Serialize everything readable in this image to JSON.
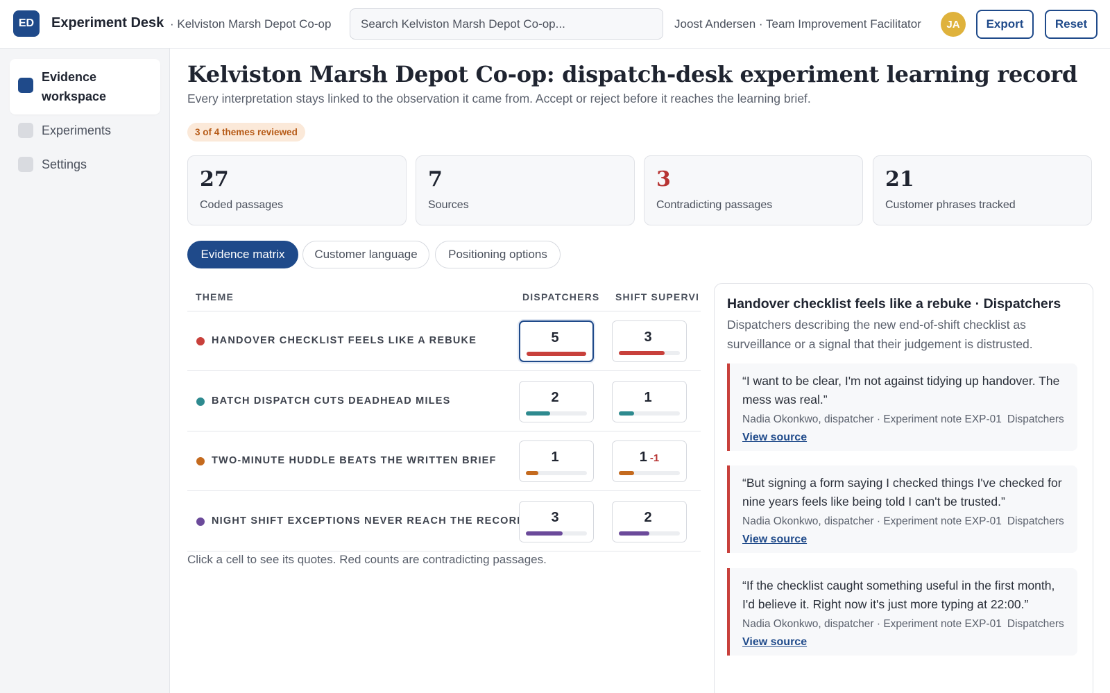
{
  "app": {
    "logo_initials": "ED",
    "title": "Experiment Desk",
    "breadcrumb": "· Kelviston Marsh Depot Co-op"
  },
  "search": {
    "placeholder": "Search Kelviston Marsh Depot Co-op..."
  },
  "user": {
    "name": "Joost Andersen · Team Improvement Facilitator",
    "initials": "JA"
  },
  "actions": {
    "export": "Export",
    "reset": "Reset"
  },
  "sidebar": {
    "items": [
      {
        "label": "Evidence workspace",
        "active": true
      },
      {
        "label": "Experiments",
        "active": false
      },
      {
        "label": "Settings",
        "active": false
      }
    ]
  },
  "page": {
    "title": "Kelviston Marsh Depot Co-op: dispatch-desk experiment learning record",
    "subtitle": "Every interpretation stays linked to the observation it came from. Accept or reject before it reaches the learning brief.",
    "review_badge": "3 of 4 themes reviewed"
  },
  "stats": [
    {
      "value": "27",
      "label": "Coded passages"
    },
    {
      "value": "7",
      "label": "Sources"
    },
    {
      "value": "3",
      "label": "Contradicting passages"
    },
    {
      "value": "21",
      "label": "Customer phrases tracked"
    }
  ],
  "tabs": [
    {
      "label": "Evidence matrix",
      "active": true
    },
    {
      "label": "Customer language",
      "active": false
    },
    {
      "label": "Positioning options",
      "active": false
    }
  ],
  "matrix": {
    "headers": [
      "THEME",
      "DISPATCHERS",
      "SHIFT SUPERVI"
    ],
    "rows": [
      {
        "theme": "HANDOVER CHECKLIST FEELS LIKE A REBUKE",
        "color": "#c8403b",
        "cells": [
          {
            "count": "5",
            "fill": 1.0,
            "contra": ""
          },
          {
            "count": "3",
            "fill": 0.75,
            "contra": ""
          }
        ]
      },
      {
        "theme": "BATCH DISPATCH CUTS DEADHEAD MILES",
        "color": "#2e8a8f",
        "cells": [
          {
            "count": "2",
            "fill": 0.4,
            "contra": ""
          },
          {
            "count": "1",
            "fill": 0.25,
            "contra": ""
          }
        ]
      },
      {
        "theme": "TWO-MINUTE HUDDLE BEATS THE WRITTEN BRIEF",
        "color": "#c46a1e",
        "cells": [
          {
            "count": "1",
            "fill": 0.2,
            "contra": ""
          },
          {
            "count": "1",
            "fill": 0.25,
            "contra": "-1"
          }
        ]
      },
      {
        "theme": "NIGHT SHIFT EXCEPTIONS NEVER REACH THE RECORD",
        "color": "#6b4a9a",
        "cells": [
          {
            "count": "3",
            "fill": 0.6,
            "contra": ""
          },
          {
            "count": "2",
            "fill": 0.5,
            "contra": ""
          }
        ]
      }
    ],
    "hint": "Click a cell to see its quotes. Red counts are contradicting passages."
  },
  "detail": {
    "title": "Handover checklist feels like a rebuke · Dispatchers",
    "description": "Dispatchers describing the new end-of-shift checklist as surveillance or a signal that their judgement is distrusted.",
    "quotes": [
      {
        "text": "“I want to be clear, I'm not against tidying up handover. The mess was real.”",
        "source": "Nadia Okonkwo, dispatcher · Experiment note EXP-01",
        "group": "Dispatchers",
        "link": "View source"
      },
      {
        "text": "“But signing a form saying I checked things I've checked for nine years feels like being told I can't be trusted.”",
        "source": "Nadia Okonkwo, dispatcher · Experiment note EXP-01",
        "group": "Dispatchers",
        "link": "View source"
      },
      {
        "text": "“If the checklist caught something useful in the first month, I'd believe it. Right now it's just more typing at 22:00.”",
        "source": "Nadia Okonkwo, dispatcher · Experiment note EXP-01",
        "group": "Dispatchers",
        "link": "View source"
      }
    ]
  },
  "colors": {
    "brand": "#1f4a8a",
    "contradict": "#b73433",
    "badge_text": "#b65a16"
  }
}
